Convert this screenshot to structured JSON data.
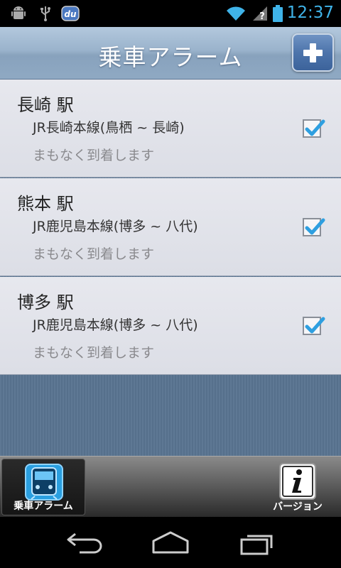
{
  "status_bar": {
    "time": "12:37",
    "icons": [
      "android-debug-icon",
      "usb-icon",
      "du-app-icon",
      "wifi-icon",
      "signal-unknown-icon",
      "battery-icon"
    ],
    "accent_color": "#3fb3e8"
  },
  "header": {
    "title": "乗車アラーム",
    "add_button_icon": "plus-icon"
  },
  "alarms": [
    {
      "station": "長崎 駅",
      "line": "JR長崎本線(鳥栖 ~ 長崎)",
      "status": "まもなく到着します",
      "enabled": true
    },
    {
      "station": "熊本 駅",
      "line": "JR鹿児島本線(博多 ~ 八代)",
      "status": "まもなく到着します",
      "enabled": true
    },
    {
      "station": "博多 駅",
      "line": "JR鹿児島本線(博多 ~ 八代)",
      "status": "まもなく到着します",
      "enabled": true
    }
  ],
  "tabs": [
    {
      "label": "乗車アラーム",
      "icon": "train-icon",
      "selected": true
    },
    {
      "label": "バージョン",
      "icon": "info-icon",
      "selected": false
    }
  ],
  "nav": {
    "icons": [
      "back-icon",
      "home-icon",
      "recent-apps-icon"
    ]
  }
}
